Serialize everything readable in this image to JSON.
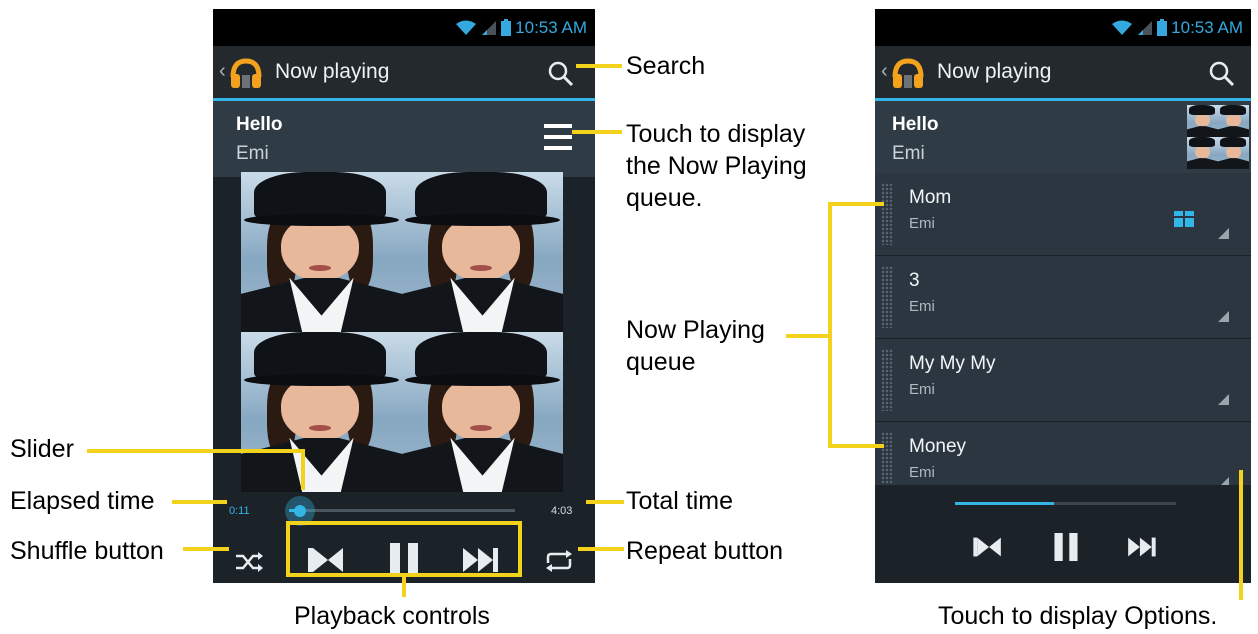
{
  "colors": {
    "accent": "#33b5e5",
    "callout": "#f3d21b",
    "screen_bg": "#1c2328"
  },
  "status_bar": {
    "time": "10:53 AM"
  },
  "left_screen": {
    "app_bar": {
      "title": "Now playing",
      "back_icon": "chevron-left-icon",
      "logo_icon": "headphones-icon",
      "search_icon": "search-icon"
    },
    "now_playing": {
      "title": "Hello",
      "artist": "Emi",
      "queue_icon": "queue-list-icon"
    },
    "playback": {
      "elapsed": "0:11",
      "total": "4:03",
      "progress": 0.05
    },
    "controls": [
      "shuffle-icon",
      "previous-icon",
      "pause-icon",
      "next-icon",
      "repeat-icon"
    ]
  },
  "right_screen": {
    "app_bar": {
      "title": "Now playing",
      "search_icon": "search-icon"
    },
    "now_playing": {
      "title": "Hello",
      "artist": "Emi"
    },
    "queue": [
      {
        "title": "Mom",
        "artist": "Emi",
        "playing": true
      },
      {
        "title": "3",
        "artist": "Emi",
        "playing": false
      },
      {
        "title": "My My My",
        "artist": "Emi",
        "playing": false
      },
      {
        "title": "Money",
        "artist": "Emi",
        "playing": false
      }
    ],
    "playback": {
      "progress": 0.45
    },
    "controls": [
      "previous-icon",
      "pause-icon",
      "next-icon"
    ]
  },
  "callouts": {
    "search": "Search",
    "queue_line1": "Touch to display",
    "queue_line2": "the Now Playing",
    "queue_line3": "queue.",
    "now_playing_queue_line1": "Now Playing",
    "now_playing_queue_line2": "queue",
    "slider": "Slider",
    "elapsed_time": "Elapsed time",
    "total_time": "Total time",
    "shuffle_button": "Shuffle button",
    "repeat_button": "Repeat button",
    "playback_controls": "Playback controls",
    "options": "Touch to display Options."
  }
}
